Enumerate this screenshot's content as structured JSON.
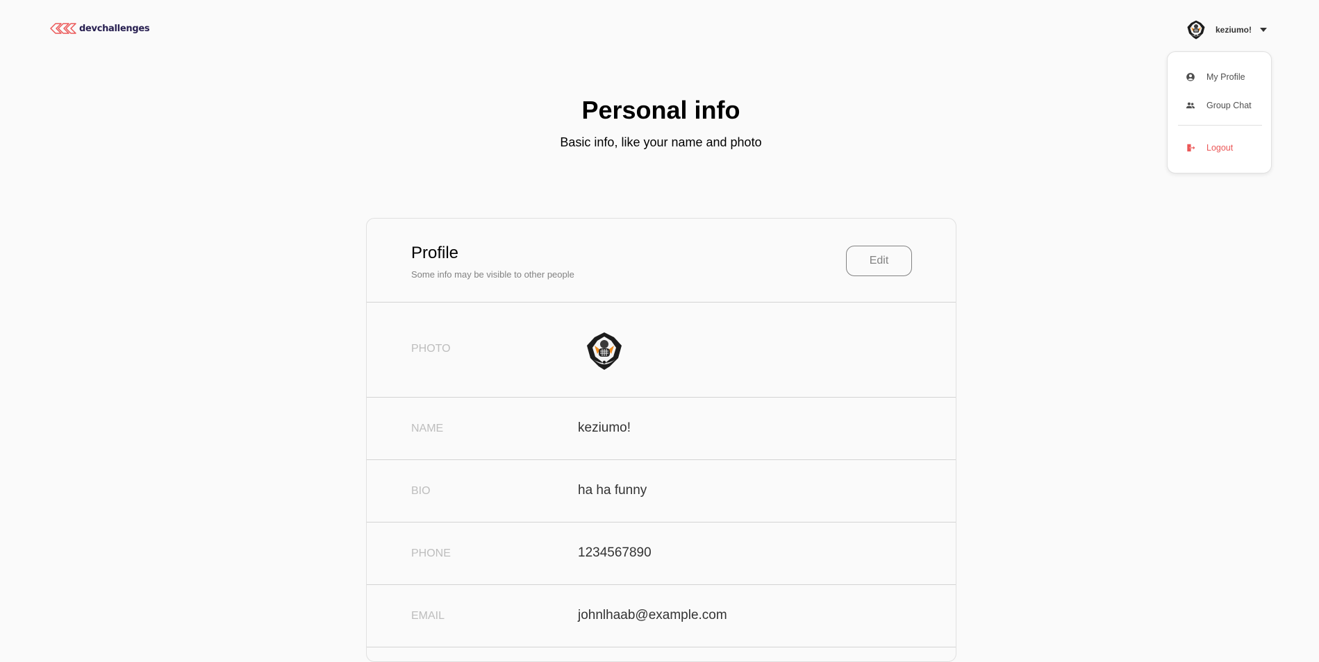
{
  "brand": {
    "name": "devchallenges",
    "color": "#282051",
    "mark_color": "#eb5757"
  },
  "user_menu": {
    "username": "keziumo!",
    "caret_icon": "caret-down-icon"
  },
  "dropdown": {
    "items": [
      {
        "label": "My Profile",
        "icon": "account-circle-icon"
      },
      {
        "label": "Group Chat",
        "icon": "group-icon"
      }
    ],
    "logout": {
      "label": "Logout",
      "icon": "logout-icon",
      "color": "#eb5757"
    }
  },
  "page": {
    "title": "Personal info",
    "subtitle": "Basic info, like your name and photo"
  },
  "profile": {
    "title": "Profile",
    "subtitle": "Some info may be visible to other people",
    "edit_label": "Edit",
    "fields": {
      "photo": {
        "label": "PHOTO"
      },
      "name": {
        "label": "NAME",
        "value": "keziumo!"
      },
      "bio": {
        "label": "BIO",
        "value": "ha ha funny"
      },
      "phone": {
        "label": "PHONE",
        "value": "1234567890"
      },
      "email": {
        "label": "EMAIL",
        "value": "johnlhaab@example.com"
      }
    }
  }
}
